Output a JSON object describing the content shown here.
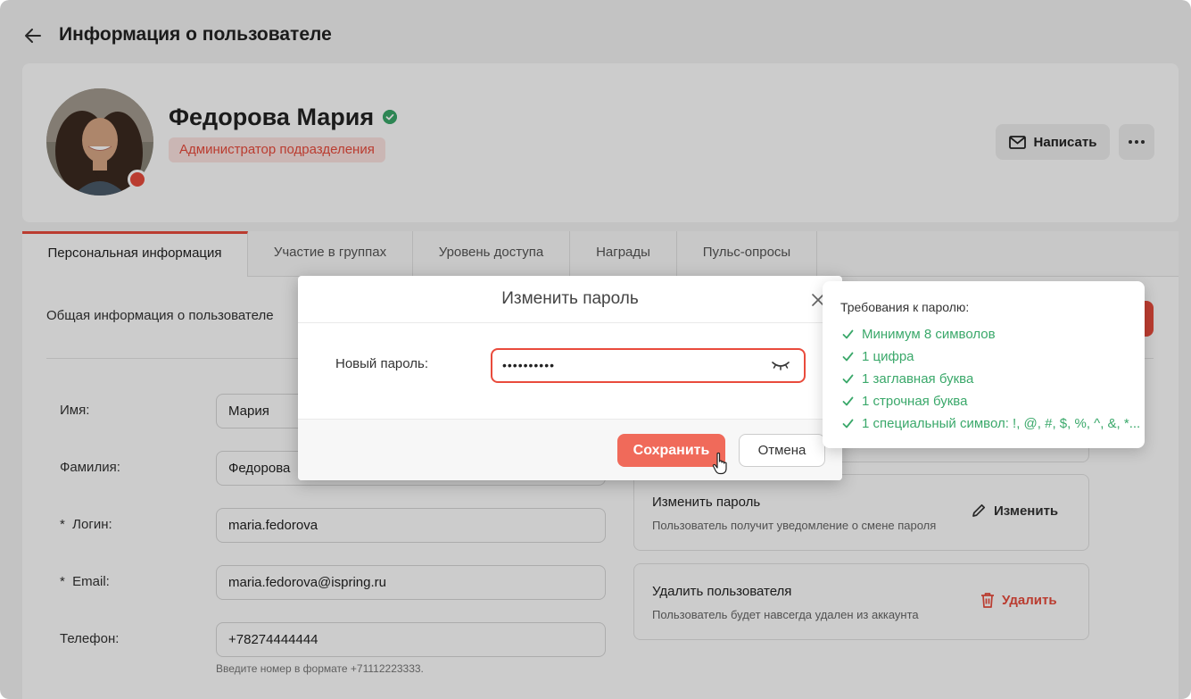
{
  "header": {
    "title": "Информация о пользователе"
  },
  "profile": {
    "name": "Федорова Мария",
    "role": "Администратор подразделения",
    "write_label": "Написать"
  },
  "tabs": [
    {
      "label": "Персональная информация",
      "active": true
    },
    {
      "label": "Участие в группах"
    },
    {
      "label": "Уровень доступа"
    },
    {
      "label": "Награды"
    },
    {
      "label": "Пульс-опросы"
    }
  ],
  "general": {
    "title": "Общая информация о пользователе"
  },
  "fields": [
    {
      "label": "Имя:",
      "value": "Мария"
    },
    {
      "label": "Фамилия:",
      "value": "Федорова"
    },
    {
      "label": "*  Логин:",
      "value": "maria.fedorova"
    },
    {
      "label": "*  Email:",
      "value": "maria.fedorova@ispring.ru"
    },
    {
      "label": "Телефон:",
      "value": "+78274444444"
    }
  ],
  "phone_hint": "Введите номер в формате +71112223333.",
  "actions": {
    "change_password": {
      "title": "Изменить пароль",
      "desc": "Пользователь получит уведомление о смене пароля",
      "button": "Изменить"
    },
    "delete_user": {
      "title": "Удалить пользователя",
      "desc": "Пользователь будет навсегда удален из аккаунта",
      "button": "Удалить"
    }
  },
  "modal": {
    "title": "Изменить пароль",
    "field_label": "Новый пароль:",
    "password_value": "••••••••••",
    "save_label": "Сохранить",
    "cancel_label": "Отмена"
  },
  "requirements": {
    "title": "Требования к паролю:",
    "items": [
      "Минимум 8 символов",
      "1 цифра",
      "1 заглавная буква",
      "1 строчная буква",
      "1 специальный символ: !, @, #, $, %, ^, &, *..."
    ]
  },
  "colors": {
    "accent": "#e94b3c",
    "button": "#f06a5a",
    "success": "#3aa86a",
    "badge_bg": "#fde4e1"
  }
}
